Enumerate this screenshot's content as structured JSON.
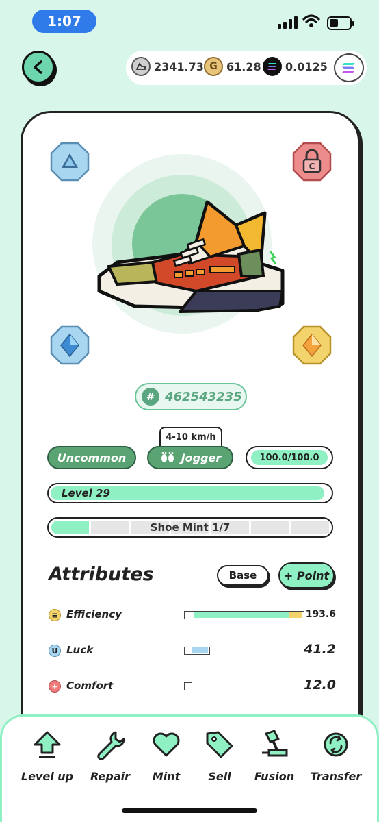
{
  "status_bar": {
    "time": "1:07"
  },
  "header": {
    "balances": [
      {
        "icon": "gst-icon",
        "value": "2341.73"
      },
      {
        "icon": "gmt-icon",
        "value": "61.28"
      },
      {
        "icon": "sol-icon",
        "value": "0.0125"
      }
    ]
  },
  "sneaker": {
    "id": "462543235",
    "speed_range": "4-10 km/h",
    "rarity": "Uncommon",
    "type": "Jogger",
    "durability": "100.0/100.0",
    "level_label": "Level 29",
    "level_progress": 0.98,
    "mint_label": "Shoe Mint 1/7",
    "mint_count": 1,
    "mint_total": 7
  },
  "attributes": {
    "title": "Attributes",
    "base_label": "Base",
    "point_label": "+ Point",
    "items": [
      {
        "name": "Efficiency",
        "value": "193.6",
        "icon_color": "#f3d36b",
        "icon_glyph": "≡"
      },
      {
        "name": "Luck",
        "value": "41.2",
        "icon_color": "#a8d6f0",
        "icon_glyph": "U"
      },
      {
        "name": "Comfort",
        "value": "12.0",
        "icon_color": "#ef7b7b",
        "icon_glyph": "+"
      }
    ]
  },
  "bottom_nav": [
    {
      "label": "Level up",
      "icon": "level-up-icon"
    },
    {
      "label": "Repair",
      "icon": "wrench-icon"
    },
    {
      "label": "Mint",
      "icon": "heart-icon"
    },
    {
      "label": "Sell",
      "icon": "tag-icon"
    },
    {
      "label": "Fusion",
      "icon": "hammer-icon"
    },
    {
      "label": "Transfer",
      "icon": "transfer-icon"
    }
  ],
  "colors": {
    "background": "#d9f6ea",
    "accent": "#8ff0c4",
    "rarity_green": "#5aa372"
  }
}
